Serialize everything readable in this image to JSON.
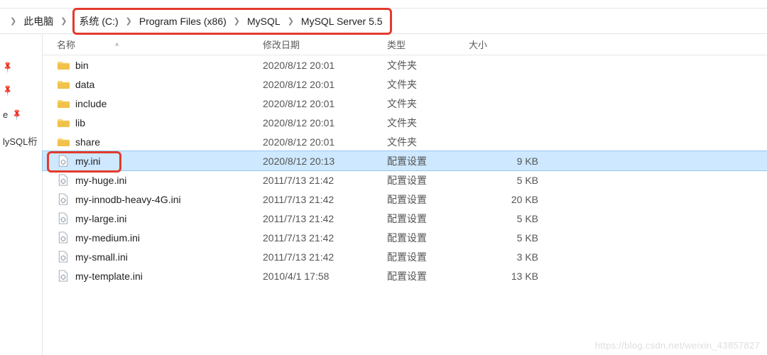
{
  "topbar": {
    "t1": "",
    "t2": "",
    "t3": "",
    "t4": ""
  },
  "breadcrumb": {
    "root": "此电脑",
    "items": [
      "系统 (C:)",
      "Program Files (x86)",
      "MySQL",
      "MySQL Server 5.5"
    ]
  },
  "columns": {
    "name": "名称",
    "date": "修改日期",
    "type": "类型",
    "size": "大小"
  },
  "sidebar": {
    "items": [
      {
        "label": ""
      },
      {
        "label": ""
      },
      {
        "label": "e"
      },
      {
        "label": "lySQL桁"
      }
    ]
  },
  "rows": [
    {
      "icon": "folder",
      "name": "bin",
      "date": "2020/8/12 20:01",
      "type": "文件夹",
      "size": ""
    },
    {
      "icon": "folder",
      "name": "data",
      "date": "2020/8/12 20:01",
      "type": "文件夹",
      "size": ""
    },
    {
      "icon": "folder",
      "name": "include",
      "date": "2020/8/12 20:01",
      "type": "文件夹",
      "size": ""
    },
    {
      "icon": "folder",
      "name": "lib",
      "date": "2020/8/12 20:01",
      "type": "文件夹",
      "size": ""
    },
    {
      "icon": "folder",
      "name": "share",
      "date": "2020/8/12 20:01",
      "type": "文件夹",
      "size": ""
    },
    {
      "icon": "ini",
      "name": "my.ini",
      "date": "2020/8/12 20:13",
      "type": "配置设置",
      "size": "9 KB",
      "selected": true,
      "highlight": true
    },
    {
      "icon": "ini",
      "name": "my-huge.ini",
      "date": "2011/7/13 21:42",
      "type": "配置设置",
      "size": "5 KB"
    },
    {
      "icon": "ini",
      "name": "my-innodb-heavy-4G.ini",
      "date": "2011/7/13 21:42",
      "type": "配置设置",
      "size": "20 KB"
    },
    {
      "icon": "ini",
      "name": "my-large.ini",
      "date": "2011/7/13 21:42",
      "type": "配置设置",
      "size": "5 KB"
    },
    {
      "icon": "ini",
      "name": "my-medium.ini",
      "date": "2011/7/13 21:42",
      "type": "配置设置",
      "size": "5 KB"
    },
    {
      "icon": "ini",
      "name": "my-small.ini",
      "date": "2011/7/13 21:42",
      "type": "配置设置",
      "size": "3 KB"
    },
    {
      "icon": "ini",
      "name": "my-template.ini",
      "date": "2010/4/1 17:58",
      "type": "配置设置",
      "size": "13 KB"
    }
  ],
  "watermark": "https://blog.csdn.net/weixin_43857827"
}
